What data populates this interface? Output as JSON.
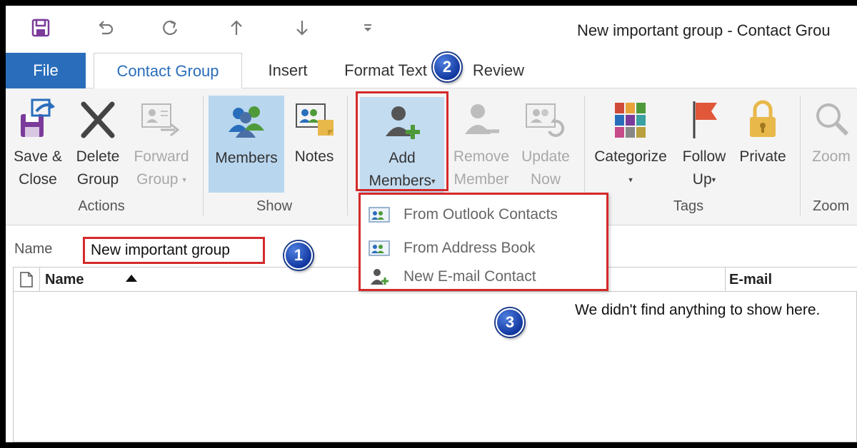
{
  "window": {
    "title": "New important group - Contact Grou"
  },
  "quick_access": {
    "save_icon": "save-icon",
    "undo_icon": "undo-icon",
    "redo_icon": "redo-icon",
    "up_icon": "arrow-up-icon",
    "down_icon": "arrow-down-icon",
    "customize_icon": "customize-icon"
  },
  "tabs": [
    {
      "label": "File"
    },
    {
      "label": "Contact Group"
    },
    {
      "label": "Insert"
    },
    {
      "label": "Format Text"
    },
    {
      "label": "Review"
    }
  ],
  "ribbon": {
    "save_close": {
      "line1": "Save &",
      "line2": "Close"
    },
    "delete_group": {
      "line1": "Delete",
      "line2": "Group"
    },
    "forward_group": {
      "line1": "Forward",
      "line2": "Group"
    },
    "members": {
      "label": "Members"
    },
    "notes": {
      "label": "Notes"
    },
    "add_members": {
      "line1": "Add",
      "line2": "Members"
    },
    "remove_member": {
      "line1": "Remove",
      "line2": "Member"
    },
    "update_now": {
      "line1": "Update",
      "line2": "Now"
    },
    "categorize": {
      "label": "Categorize"
    },
    "follow_up": {
      "line1": "Follow",
      "line2": "Up"
    },
    "private": {
      "label": "Private"
    },
    "zoom": {
      "label": "Zoom"
    },
    "groups": {
      "actions": "Actions",
      "show": "Show",
      "tags": "Tags",
      "zoom": "Zoom"
    }
  },
  "form": {
    "name_label": "Name",
    "name_value": "New important group"
  },
  "list": {
    "col_name": "Name",
    "col_email": "E-mail",
    "empty_message": "We didn't find anything to show here."
  },
  "dropdown": {
    "items": [
      {
        "label": "From Outlook Contacts"
      },
      {
        "label": "From Address Book"
      },
      {
        "label": "New E-mail Contact"
      }
    ]
  },
  "callouts": [
    "1",
    "2",
    "3"
  ],
  "colors": {
    "accent": "#2a6ebb",
    "highlight_red": "#d42a2a",
    "callout_blue": "#1238a0"
  }
}
